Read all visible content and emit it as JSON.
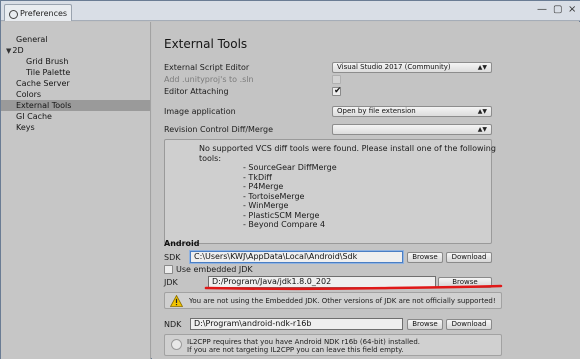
{
  "window": {
    "title": "Preferences",
    "controls": {
      "minimize": "—",
      "maximize": "▢",
      "close": "×"
    }
  },
  "sidebar": {
    "items": [
      {
        "label": "General",
        "level": "top"
      },
      {
        "label": "2D",
        "level": "category",
        "expanded": true
      },
      {
        "label": "Grid Brush",
        "level": "child"
      },
      {
        "label": "Tile Palette",
        "level": "child"
      },
      {
        "label": "Cache Server",
        "level": "top"
      },
      {
        "label": "Colors",
        "level": "top"
      },
      {
        "label": "External Tools",
        "level": "top",
        "selected": true
      },
      {
        "label": "GI Cache",
        "level": "top"
      },
      {
        "label": "Keys",
        "level": "top"
      }
    ]
  },
  "main": {
    "heading": "External Tools",
    "script_editor": {
      "label": "External Script Editor",
      "value": "Visual Studio 2017 (Community)"
    },
    "add_sln": {
      "label": "Add .unityproj's to .sln",
      "checked": false,
      "disabled": true
    },
    "editor_attaching": {
      "label": "Editor Attaching",
      "checked": true
    },
    "image_application": {
      "label": "Image application",
      "value": "Open by file extension"
    },
    "vcs": {
      "label": "Revision Control Diff/Merge",
      "value": ""
    },
    "vcs_message": {
      "line1": "No supported VCS diff tools were found. Please install one of the following",
      "line2": "tools:",
      "tools": [
        "- SourceGear DiffMerge",
        "- TkDiff",
        "- P4Merge",
        "- TortoiseMerge",
        "- WinMerge",
        "- PlasticSCM Merge",
        "- Beyond Compare 4"
      ]
    },
    "android": {
      "section_title": "Android",
      "sdk": {
        "label": "SDK",
        "value": "C:\\Users\\KWJ\\AppData\\Local\\Android\\Sdk",
        "browse": "Browse",
        "download": "Download"
      },
      "use_embedded_jdk": {
        "label": "Use embedded JDK",
        "checked": false
      },
      "jdk": {
        "label": "JDK",
        "value": "D:/Program/Java/jdk1.8.0_202",
        "browse": "Browse"
      },
      "jdk_warning": "You are not using the Embedded JDK. Other versions of JDK are not officially supported!",
      "ndk": {
        "label": "NDK",
        "value": "D:\\Program\\android-ndk-r16b",
        "browse": "Browse",
        "download": "Download"
      },
      "il2cpp_info": {
        "line1": "IL2CPP requires that you have Android NDK r16b (64-bit) installed.",
        "line2": "If you are not targeting IL2CPP you can leave this field empty."
      }
    }
  },
  "colors": {
    "annotation_red": "#e01818",
    "warning_yellow": "#f2c400",
    "selection": "#9a9a9a"
  }
}
